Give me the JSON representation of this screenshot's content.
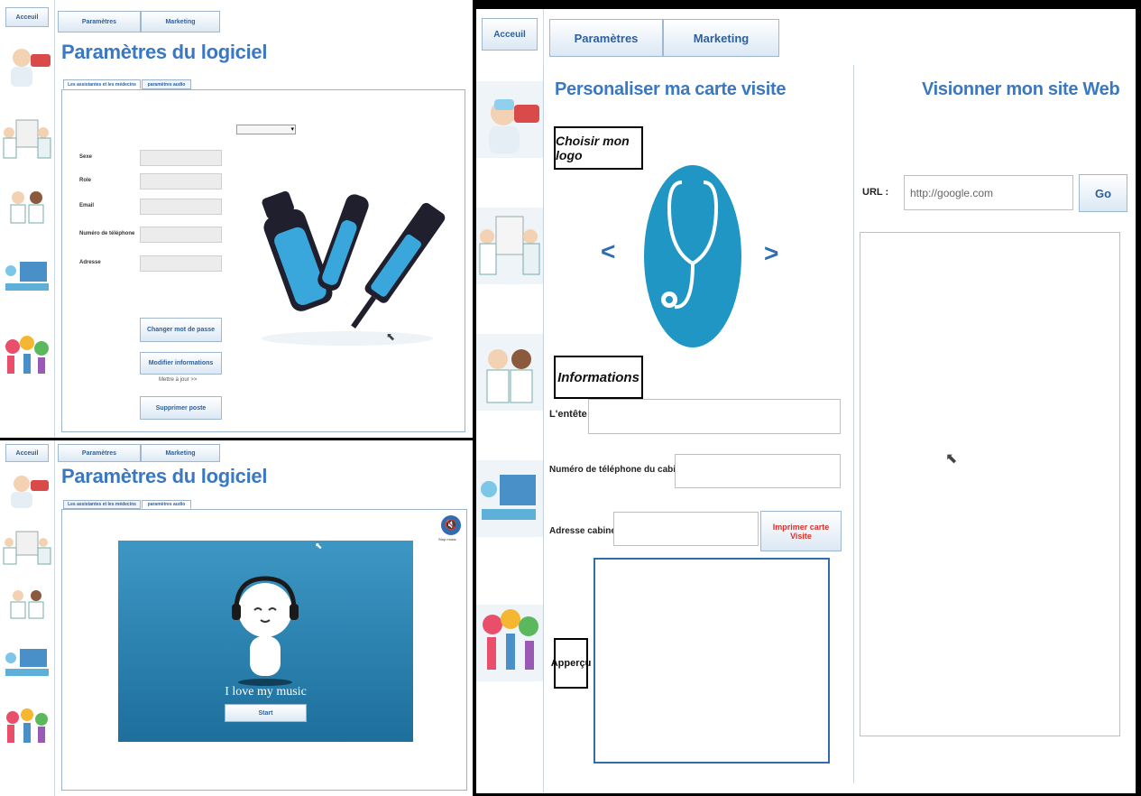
{
  "top_left": {
    "nav": {
      "home": "Acceuil",
      "tab_params": "Paramètres",
      "tab_marketing": "Marketing"
    },
    "title": "Paramètres du logiciel",
    "tabs": [
      "Les assistantes et les médecins",
      "paramètres audio"
    ],
    "form": {
      "labels": [
        "Sexe",
        "Role",
        "Email",
        "Numéro de téléphone",
        "Adresse"
      ],
      "buttons": {
        "change_password": "Changer mot de passe",
        "modify_info": "Modifier informations",
        "delete_post": "Supprimer poste"
      },
      "update_hint": "Mettre à jour >>"
    }
  },
  "bottom_left": {
    "nav": {
      "home": "Acceuil",
      "tab_params": "Paramètres",
      "tab_marketing": "Marketing"
    },
    "title": "Paramètres du logiciel",
    "tabs": [
      "Les assistantes et les médecins",
      "paramètres audio"
    ],
    "stop_music_label": "Stop music",
    "music_caption": "I love my music",
    "start_button": "Start"
  },
  "right": {
    "nav": {
      "home": "Acceuil",
      "tab_params": "Paramètres",
      "tab_marketing": "Marketing"
    },
    "card": {
      "heading": "Personaliser ma carte visite",
      "choose_logo": "Choisir mon logo",
      "prev_arrow": "<",
      "next_arrow": ">",
      "info_heading": "Informations",
      "field_header_label": "L'entête",
      "field_phone_label": "Numéro de téléphone du cabinet",
      "field_address_label": "Adresse cabinet",
      "print_button": "Imprimer carte Visite",
      "preview_label": "Apperçu"
    },
    "website": {
      "heading": "Visionner mon site Web",
      "url_label": "URL :",
      "url_value": "http://google.com",
      "go_button": "Go"
    }
  },
  "colors": {
    "accent": "#2f6db0",
    "title_blue": "#3b78c2",
    "print_red": "#d9332b",
    "music_bg": "#2a86b5",
    "logo_circle": "#1f96c4"
  }
}
